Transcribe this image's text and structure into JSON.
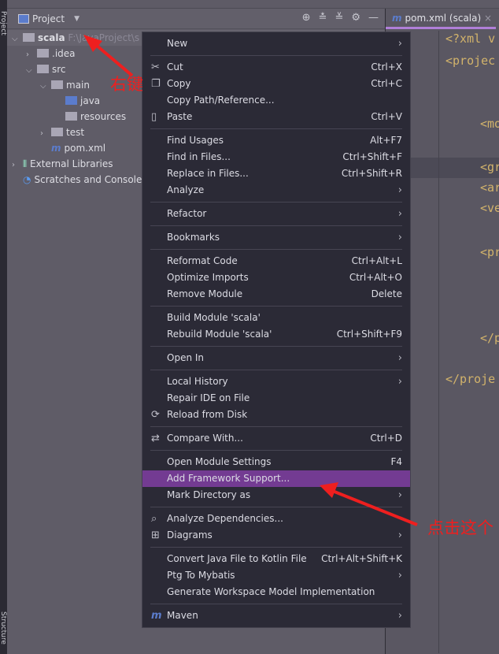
{
  "side_stripe": {
    "top_label": "Project",
    "bottom_label": "Structure"
  },
  "project_panel": {
    "title": "Project",
    "toolbar_icons": [
      "locate-icon",
      "expand-all-icon",
      "collapse-all-icon",
      "gear-icon",
      "minimize-icon"
    ]
  },
  "tree": [
    {
      "label": "scala",
      "hint": "F:\\JavaProject\\s",
      "type": "module",
      "depth": 0,
      "expanded": true
    },
    {
      "label": ".idea",
      "type": "folder",
      "depth": 1,
      "expanded": false
    },
    {
      "label": "src",
      "type": "folder",
      "depth": 1,
      "expanded": true
    },
    {
      "label": "main",
      "type": "folder",
      "depth": 2,
      "expanded": true
    },
    {
      "label": "java",
      "type": "source-folder",
      "depth": 3
    },
    {
      "label": "resources",
      "type": "resources-folder",
      "depth": 3
    },
    {
      "label": "test",
      "type": "folder",
      "depth": 2,
      "expanded": false
    },
    {
      "label": "pom.xml",
      "type": "maven-file",
      "depth": 2
    },
    {
      "label": "External Libraries",
      "type": "libraries",
      "depth": 0,
      "expanded": false
    },
    {
      "label": "Scratches and Console",
      "type": "scratches",
      "depth": 0
    }
  ],
  "editor": {
    "tab_label": "pom.xml (scala)",
    "lines": [
      "<?xml v",
      "<projec",
      "<mo",
      "<gr",
      "<ar",
      "<ve",
      "<pr",
      "</p",
      "</proje"
    ]
  },
  "context_menu": [
    [
      {
        "label": "New",
        "submenu": true
      }
    ],
    [
      {
        "label": "Cut",
        "shortcut": "Ctrl+X",
        "icon": "scissors-icon"
      },
      {
        "label": "Copy",
        "shortcut": "Ctrl+C",
        "icon": "copy-icon"
      },
      {
        "label": "Copy Path/Reference..."
      },
      {
        "label": "Paste",
        "shortcut": "Ctrl+V",
        "icon": "clipboard-icon"
      }
    ],
    [
      {
        "label": "Find Usages",
        "shortcut": "Alt+F7"
      },
      {
        "label": "Find in Files...",
        "shortcut": "Ctrl+Shift+F"
      },
      {
        "label": "Replace in Files...",
        "shortcut": "Ctrl+Shift+R"
      },
      {
        "label": "Analyze",
        "submenu": true
      }
    ],
    [
      {
        "label": "Refactor",
        "submenu": true
      }
    ],
    [
      {
        "label": "Bookmarks",
        "submenu": true
      }
    ],
    [
      {
        "label": "Reformat Code",
        "shortcut": "Ctrl+Alt+L"
      },
      {
        "label": "Optimize Imports",
        "shortcut": "Ctrl+Alt+O"
      },
      {
        "label": "Remove Module",
        "shortcut": "Delete"
      }
    ],
    [
      {
        "label": "Build Module 'scala'"
      },
      {
        "label": "Rebuild Module 'scala'",
        "shortcut": "Ctrl+Shift+F9"
      }
    ],
    [
      {
        "label": "Open In",
        "submenu": true
      }
    ],
    [
      {
        "label": "Local History",
        "submenu": true
      },
      {
        "label": "Repair IDE on File"
      },
      {
        "label": "Reload from Disk",
        "icon": "reload-icon"
      }
    ],
    [
      {
        "label": "Compare With...",
        "shortcut": "Ctrl+D",
        "icon": "compare-icon"
      }
    ],
    [
      {
        "label": "Open Module Settings",
        "shortcut": "F4"
      },
      {
        "label": "Add Framework Support...",
        "active": true
      },
      {
        "label": "Mark Directory as",
        "submenu": true
      }
    ],
    [
      {
        "label": "Analyze Dependencies...",
        "icon": "analyze-dependencies-icon"
      },
      {
        "label": "Diagrams",
        "submenu": true,
        "icon": "diagram-icon"
      }
    ],
    [
      {
        "label": "Convert Java File to Kotlin File",
        "shortcut": "Ctrl+Alt+Shift+K"
      },
      {
        "label": "Ptg To Mybatis",
        "submenu": true
      },
      {
        "label": "Generate Workspace Model Implementation"
      }
    ],
    [
      {
        "label": "Maven",
        "submenu": true,
        "icon": "maven-icon"
      }
    ]
  ],
  "annotations": {
    "right_click": "右键",
    "click_this": "点击这个"
  },
  "colors": {
    "highlight": "#733b92",
    "menu_bg": "#2b2a36",
    "annotation": "#ee1f1f",
    "accent_blue": "#5b7ccc"
  }
}
